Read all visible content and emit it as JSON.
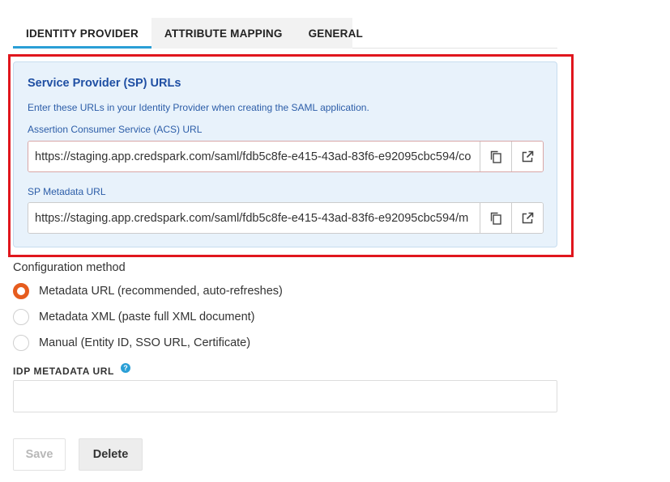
{
  "tabs": [
    {
      "label": "IDENTITY PROVIDER",
      "active": true
    },
    {
      "label": "ATTRIBUTE MAPPING",
      "active": false
    },
    {
      "label": "GENERAL",
      "active": false
    }
  ],
  "sp_panel": {
    "title": "Service Provider (SP) URLs",
    "description": "Enter these URLs in your Identity Provider when creating the SAML application.",
    "acs": {
      "label": "Assertion Consumer Service (ACS) URL",
      "value": "https://staging.app.credspark.com/saml/fdb5c8fe-e415-43ad-83f6-e92095cbc594/co"
    },
    "metadata": {
      "label": "SP Metadata URL",
      "value": "https://staging.app.credspark.com/saml/fdb5c8fe-e415-43ad-83f6-e92095cbc594/m"
    },
    "icons": {
      "copy": "copy-icon",
      "open": "external-link-icon"
    }
  },
  "config": {
    "label": "Configuration method",
    "options": [
      {
        "label": "Metadata URL (recommended, auto-refreshes)",
        "selected": true
      },
      {
        "label": "Metadata XML (paste full XML document)",
        "selected": false
      },
      {
        "label": "Manual (Entity ID, SSO URL, Certificate)",
        "selected": false
      }
    ]
  },
  "idp": {
    "label": "IDP METADATA URL",
    "help": "?",
    "value": ""
  },
  "buttons": {
    "save": "Save",
    "delete": "Delete"
  },
  "colors": {
    "accent": "#2a9fd6",
    "radio_selected": "#e65c1e",
    "highlight": "#e0161d",
    "panel_bg": "#e8f2fb",
    "panel_title": "#1f4fa3"
  }
}
